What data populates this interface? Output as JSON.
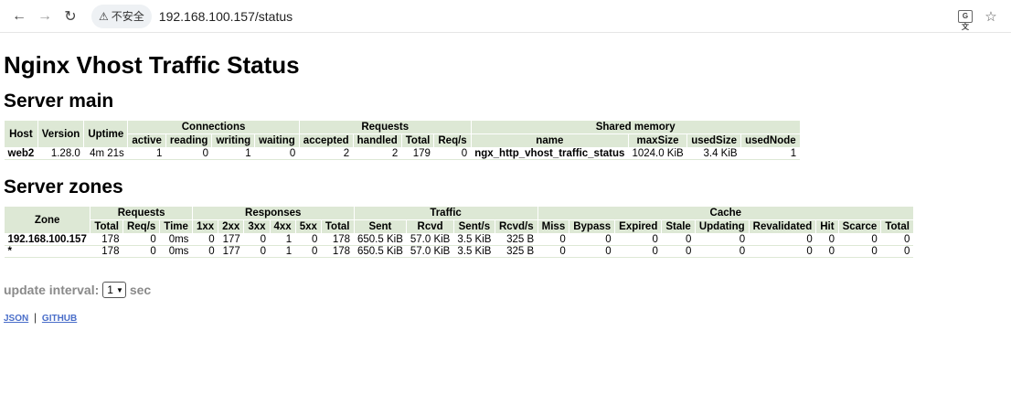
{
  "browser": {
    "security_label": "不安全",
    "url": "192.168.100.157/status"
  },
  "page": {
    "title": "Nginx Vhost Traffic Status"
  },
  "server_main": {
    "heading": "Server main",
    "group_headers": {
      "host": "Host",
      "version": "Version",
      "uptime": "Uptime",
      "connections": "Connections",
      "requests": "Requests",
      "shared_memory": "Shared memory"
    },
    "sub_headers": [
      "active",
      "reading",
      "writing",
      "waiting",
      "accepted",
      "handled",
      "Total",
      "Req/s",
      "name",
      "maxSize",
      "usedSize",
      "usedNode"
    ],
    "rows": [
      [
        "web2",
        "1.28.0",
        "4m 21s",
        "1",
        "0",
        "1",
        "0",
        "2",
        "2",
        "179",
        "0",
        "ngx_http_vhost_traffic_status",
        "1024.0 KiB",
        "3.4 KiB",
        "1"
      ]
    ]
  },
  "server_zones": {
    "heading": "Server zones",
    "group_headers": {
      "zone": "Zone",
      "requests": "Requests",
      "responses": "Responses",
      "traffic": "Traffic",
      "cache": "Cache"
    },
    "sub_headers": [
      "Total",
      "Req/s",
      "Time",
      "1xx",
      "2xx",
      "3xx",
      "4xx",
      "5xx",
      "Total",
      "Sent",
      "Rcvd",
      "Sent/s",
      "Rcvd/s",
      "Miss",
      "Bypass",
      "Expired",
      "Stale",
      "Updating",
      "Revalidated",
      "Hit",
      "Scarce",
      "Total"
    ],
    "rows": [
      [
        "192.168.100.157",
        "178",
        "0",
        "0ms",
        "0",
        "177",
        "0",
        "1",
        "0",
        "178",
        "650.5 KiB",
        "57.0 KiB",
        "3.5 KiB",
        "325 B",
        "0",
        "0",
        "0",
        "0",
        "0",
        "0",
        "0",
        "0",
        "0"
      ],
      [
        "*",
        "178",
        "0",
        "0ms",
        "0",
        "177",
        "0",
        "1",
        "0",
        "178",
        "650.5 KiB",
        "57.0 KiB",
        "3.5 KiB",
        "325 B",
        "0",
        "0",
        "0",
        "0",
        "0",
        "0",
        "0",
        "0",
        "0"
      ]
    ]
  },
  "update": {
    "label": "update interval:",
    "value": "1",
    "unit": "sec"
  },
  "links": {
    "json": "JSON",
    "github": "GITHUB"
  }
}
